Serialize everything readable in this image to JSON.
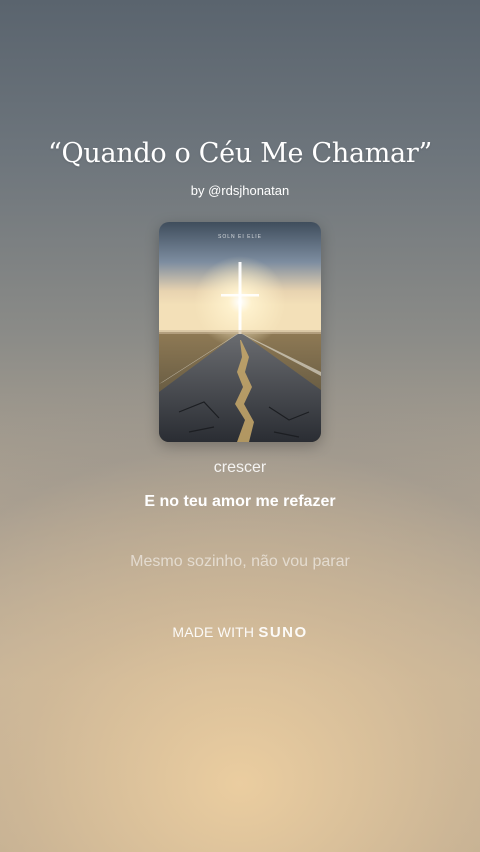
{
  "song": {
    "title": "“Quando o Céu Me Chamar”",
    "byline": "by @rdsjhonatan",
    "cover_caption": "SOLN EI ELIE"
  },
  "lyrics": {
    "previous": "crescer",
    "current": "E no teu amor me refazer",
    "next": "Mesmo sozinho, não vou parar"
  },
  "footer": {
    "made_with": "MADE WITH",
    "brand": "SUNO"
  },
  "colors": {
    "text": "#ffffff",
    "sky_top": "#5a646e",
    "glow": "#ecd0a0"
  }
}
